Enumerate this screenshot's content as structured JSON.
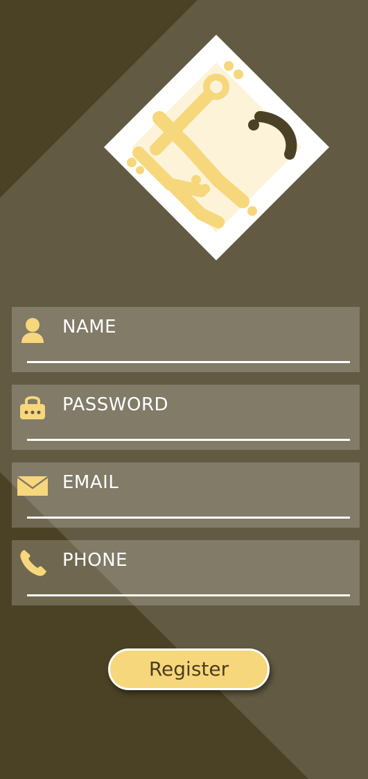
{
  "colors": {
    "background": "#625a42",
    "dark_band": "#4b4125",
    "field_fill": "#817a66",
    "accent": "#f7d77c",
    "text": "#ffffff",
    "button_text": "#4a3d1f"
  },
  "logo": {
    "icon": "arabic-calligraphy-logo"
  },
  "form": {
    "fields": [
      {
        "label": "NAME",
        "icon": "person-icon"
      },
      {
        "label": "PASSWORD",
        "icon": "lock-icon"
      },
      {
        "label": "EMAIL",
        "icon": "envelope-icon"
      },
      {
        "label": "PHONE",
        "icon": "phone-icon"
      }
    ],
    "register_label": "Register"
  }
}
